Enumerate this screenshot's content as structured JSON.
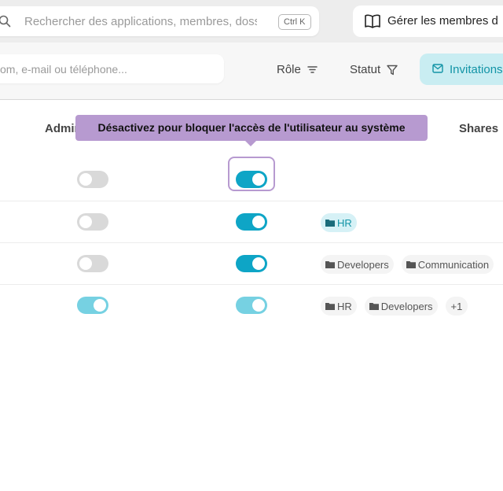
{
  "topbar": {
    "search": {
      "placeholder": "Rechercher des applications, membres, dossiers",
      "shortcut": "Ctrl K"
    },
    "manage_button": "Gérer les membres d"
  },
  "filters": {
    "search_placeholder": "om, e-mail ou téléphone...",
    "role_label": "Rôle",
    "status_label": "Statut",
    "invitations_label": "Invitations"
  },
  "table": {
    "columns": {
      "admin": "Admin",
      "shares": "Shares"
    },
    "tooltip": "Désactivez pour bloquer l'accès de l'utilisateur au système",
    "rows": [
      {
        "admin": "off",
        "active": "on",
        "shares": []
      },
      {
        "admin": "off",
        "active": "on",
        "shares": [
          {
            "label": "HR",
            "highlight": true
          }
        ]
      },
      {
        "admin": "off",
        "active": "on",
        "shares": [
          {
            "label": "Developers"
          },
          {
            "label": "Communication"
          }
        ]
      },
      {
        "admin": "on-light",
        "active": "on-light",
        "shares": [
          {
            "label": "HR"
          },
          {
            "label": "Developers"
          }
        ],
        "more": "+1"
      }
    ]
  },
  "colors": {
    "accent": "#0ea5c6",
    "tooltip": "#b79ad0",
    "invite_bg": "#c9edf2"
  }
}
